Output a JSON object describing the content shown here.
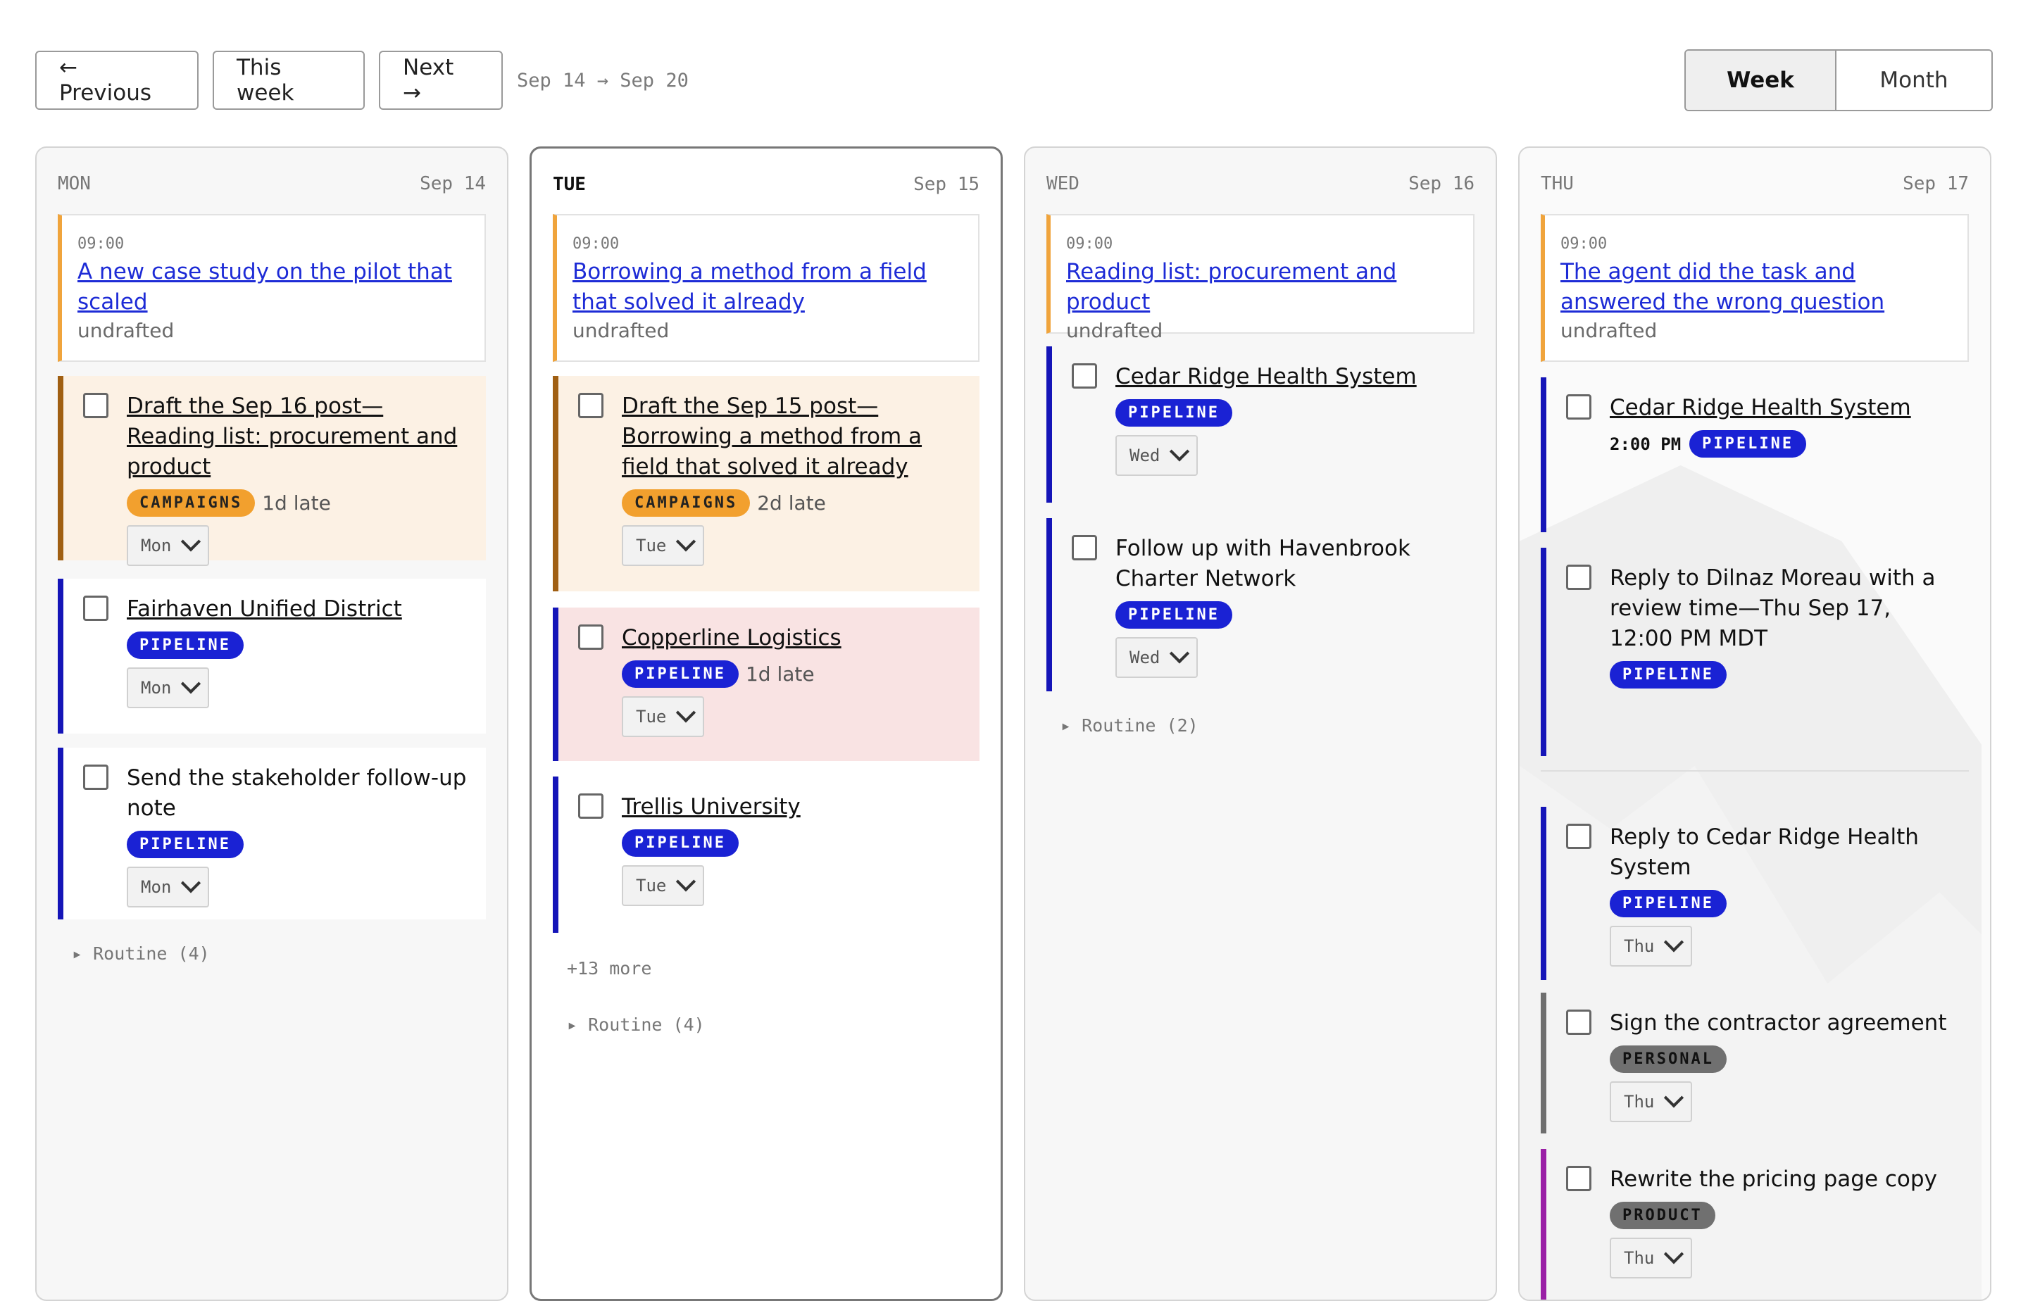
{
  "toolbar": {
    "prev_label": "← Previous",
    "this_week_label": "This week",
    "next_label": "Next →",
    "range_label": "Sep 14 → Sep 20",
    "view_week_label": "Week",
    "view_month_label": "Month",
    "active_view": "Week"
  },
  "colors": {
    "pipeline": "#1a22d4",
    "campaigns": "#f2a02e",
    "link": "#1d2bd6",
    "post_border": "#f0a43c"
  },
  "days": [
    {
      "name": "MON",
      "date": "Sep 14",
      "post": {
        "time": "09:00",
        "title": "A new case study on the pilot that scaled",
        "status": "undrafted"
      },
      "tasks": [
        {
          "title": "Draft the Sep 16 post—Reading list: procurement and product",
          "tag": "CAMPAIGNS",
          "late": "1d late",
          "day": "Mon"
        },
        {
          "title": "Fairhaven Unified District",
          "tag": "PIPELINE",
          "day": "Mon"
        },
        {
          "title": "Send the stakeholder follow-up note",
          "tag": "PIPELINE",
          "day": "Mon"
        }
      ],
      "routine": "▸ Routine (4)"
    },
    {
      "name": "TUE",
      "date": "Sep 15",
      "post": {
        "time": "09:00",
        "title": "Borrowing a method from a field that solved it already",
        "status": "undrafted"
      },
      "tasks": [
        {
          "title": "Draft the Sep 15 post—Borrowing a method from a field that solved it already",
          "tag": "CAMPAIGNS",
          "late": "2d late",
          "day": "Tue"
        },
        {
          "title": "Copperline Logistics",
          "tag": "PIPELINE",
          "late": "1d late",
          "day": "Tue"
        },
        {
          "title": "Trellis University",
          "tag": "PIPELINE",
          "day": "Tue"
        }
      ],
      "more": "+13 more",
      "routine": "▸ Routine (4)"
    },
    {
      "name": "WED",
      "date": "Sep 16",
      "post": {
        "time": "09:00",
        "title": "Reading list: procurement and product",
        "status": "undrafted"
      },
      "tasks": [
        {
          "title": "Cedar Ridge Health System",
          "tag": "PIPELINE",
          "day": "Wed"
        },
        {
          "title": "Follow up with Havenbrook Charter Network",
          "tag": "PIPELINE",
          "day": "Wed"
        }
      ],
      "routine": "▸ Routine (2)"
    },
    {
      "name": "THU",
      "date": "Sep 17",
      "post": {
        "time": "09:00",
        "title": "The agent did the task and answered the wrong question",
        "status": "undrafted"
      },
      "tasks": [
        {
          "title": "Cedar Ridge Health System",
          "time": "2:00 PM",
          "tag": "PIPELINE"
        },
        {
          "title": "Reply to Dilnaz Moreau with a review time—Thu Sep 17, 12:00 PM MDT",
          "tag": "PIPELINE"
        },
        {
          "title": "Reply to Cedar Ridge Health System",
          "tag": "PIPELINE",
          "day": "Thu"
        },
        {
          "title": "Sign the contractor agreement",
          "tag": "PERSONAL",
          "day": "Thu"
        },
        {
          "title": "Rewrite the pricing page copy",
          "tag": "PRODUCT",
          "day": "Thu"
        }
      ]
    }
  ]
}
